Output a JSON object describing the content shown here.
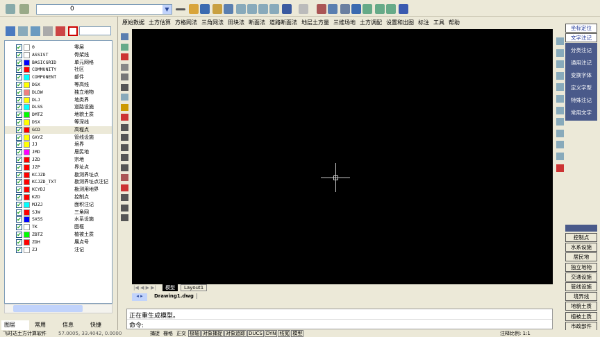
{
  "toolbar": {
    "layer_value": "0"
  },
  "left_panel": {
    "layers": [
      {
        "name": "0",
        "desc": "零层",
        "color": "#ffffff"
      },
      {
        "name": "ASSIST",
        "desc": "骨架线",
        "color": "#ffffff"
      },
      {
        "name": "BASICGRID",
        "desc": "单元网格",
        "color": "#0000ff"
      },
      {
        "name": "COMMUNITY",
        "desc": "社区",
        "color": "#ff0000"
      },
      {
        "name": "COMPONENT",
        "desc": "部件",
        "color": "#00ffff"
      },
      {
        "name": "DGX",
        "desc": "等高线",
        "color": "#ffff00"
      },
      {
        "name": "DLDW",
        "desc": "独立地物",
        "color": "#f08080"
      },
      {
        "name": "DLJ",
        "desc": "地类界",
        "color": "#ffff00"
      },
      {
        "name": "DLSS",
        "desc": "道路设施",
        "color": "#00ffff"
      },
      {
        "name": "DMTZ",
        "desc": "地貌土质",
        "color": "#00ff00"
      },
      {
        "name": "DSX",
        "desc": "等深线",
        "color": "#ffff00"
      },
      {
        "name": "GCD",
        "desc": "高程点",
        "color": "#ff0000"
      },
      {
        "name": "GXYZ",
        "desc": "管线设施",
        "color": "#ffff00"
      },
      {
        "name": "JJ",
        "desc": "境界",
        "color": "#ffff00"
      },
      {
        "name": "JMD",
        "desc": "居民地",
        "color": "#ff00ff"
      },
      {
        "name": "JZD",
        "desc": "宗地",
        "color": "#ff0000"
      },
      {
        "name": "JZP",
        "desc": "界址点",
        "color": "#ff0000"
      },
      {
        "name": "KCJZD",
        "desc": "勘测界址点",
        "color": "#ff0000"
      },
      {
        "name": "KCJZD_TXT",
        "desc": "勘测界址点注记",
        "color": "#ff0000"
      },
      {
        "name": "KCYDJ",
        "desc": "勘测用地界",
        "color": "#ff0000"
      },
      {
        "name": "KZD",
        "desc": "控制点",
        "color": "#ff0000"
      },
      {
        "name": "MJZJ",
        "desc": "面积注记",
        "color": "#00ffff"
      },
      {
        "name": "SJW",
        "desc": "三角网",
        "color": "#ff0000"
      },
      {
        "name": "SXSS",
        "desc": "水系设施",
        "color": "#0000ff"
      },
      {
        "name": "TK",
        "desc": "图框",
        "color": "#ffffff"
      },
      {
        "name": "ZBTZ",
        "desc": "植被土质",
        "color": "#00ff00"
      },
      {
        "name": "ZDH",
        "desc": "展点号",
        "color": "#ff0000"
      },
      {
        "name": "ZJ",
        "desc": "注记",
        "color": "#ffffff"
      }
    ],
    "selected_layer": "GCD",
    "tabs": [
      "图层",
      "常用",
      "信息",
      "快捷"
    ]
  },
  "menubar": [
    "原始数据",
    "土方估算",
    "方格网法",
    "三角网法",
    "田块法",
    "断面法",
    "道路断面法",
    "地层土方量",
    "三维场地",
    "土方调配",
    "设置和出图",
    "标注",
    "工具",
    "帮助"
  ],
  "layout_tabs": [
    "模型",
    "Layout1"
  ],
  "doc_tab": "Drawing1.dwg",
  "command": {
    "history": "正在重生成模型。",
    "prompt": "命令:"
  },
  "right_panel": {
    "top_buttons": [
      "坐标定位",
      "文字注记"
    ],
    "text_buttons": [
      "分类注记",
      "通用注记",
      "变换字体",
      "定义字型",
      "特殊注记",
      "常用文字"
    ],
    "bottom_buttons": [
      "控制点",
      "水系设施",
      "居民地",
      "独立地物",
      "交通设施",
      "管线设施",
      "境界线",
      "地貌土质",
      "植被土质",
      "市政部件"
    ]
  },
  "status": {
    "app": "飞时达土方计算软件",
    "coords": "57.0005, 33.4042, 0.0000",
    "toggles": [
      "捕捉",
      "栅格",
      "正交",
      "极轴",
      "对象捕捉",
      "对象追踪",
      "DUCS",
      "DYN",
      "线宽",
      "模型"
    ],
    "annotation_scale": "注释比例: 1:1"
  }
}
